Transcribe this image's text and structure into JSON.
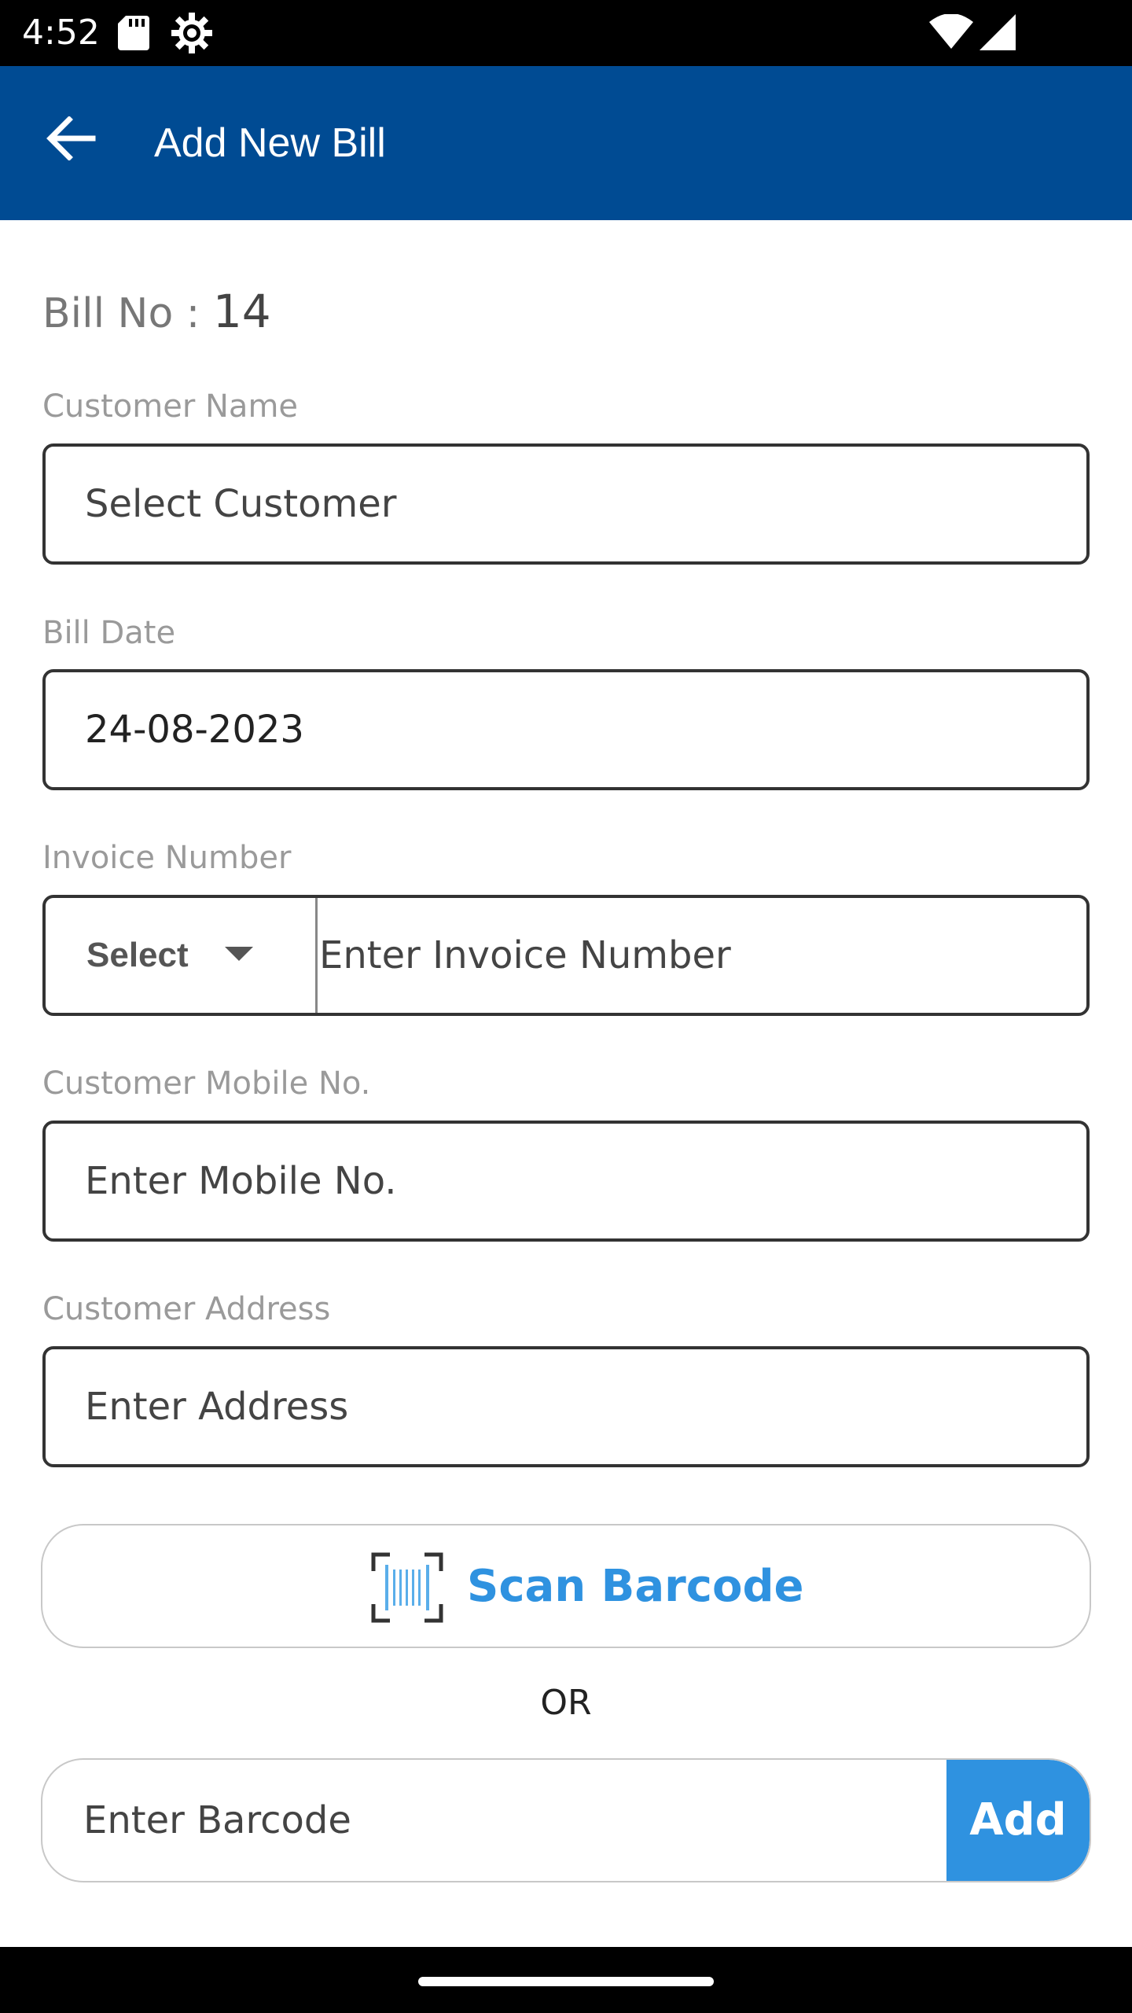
{
  "status_bar": {
    "time": "4:52",
    "icons": [
      "sd-card-icon",
      "gear-icon",
      "wifi-icon",
      "signal-icon"
    ]
  },
  "app_bar": {
    "title": "Add New Bill",
    "back_icon": "arrow-left-icon",
    "background": "#004b93"
  },
  "bill": {
    "label": "Bill No : ",
    "number": "14"
  },
  "customer_name": {
    "label": "Customer Name",
    "value": "Select Customer"
  },
  "bill_date": {
    "label": "Bill Date",
    "value": "24-08-2023"
  },
  "invoice_number": {
    "label": "Invoice Number",
    "select_value": "Select",
    "placeholder": "Enter Invoice Number"
  },
  "customer_mobile": {
    "label": "Customer Mobile No.",
    "placeholder": "Enter Mobile No."
  },
  "customer_address": {
    "label": "Customer Address",
    "placeholder": "Enter Address"
  },
  "scan": {
    "label": "Scan Barcode",
    "icon": "barcode-scan-icon",
    "color": "#2f92e0"
  },
  "or_text": "OR",
  "barcode": {
    "placeholder": "Enter Barcode",
    "add_label": "Add"
  }
}
